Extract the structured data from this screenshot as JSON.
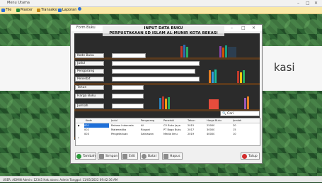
{
  "app": {
    "title": "Menu Utama",
    "menu": [
      {
        "label": "File",
        "icon": "file-icon",
        "color": "#2f6fd6"
      },
      {
        "label": "Master",
        "icon": "master-icon",
        "color": "#2a8a3c"
      },
      {
        "label": "Transaksi",
        "icon": "transaksi-icon",
        "color": "#c48a1a"
      },
      {
        "label": "Laporan",
        "icon": "laporan-icon",
        "color": "#2f6fd6"
      },
      {
        "label": "",
        "icon": "info-icon",
        "color": "#2f6fd6"
      }
    ],
    "banner_text": "kasi",
    "status": "USER: ADMIN   Admin: 12345   Hak akses: Admin   Tanggal: 11/05/2022   09:42:36 AM"
  },
  "form": {
    "title": "Form Buku",
    "heading_line1": "INPUT DATA BUKU",
    "heading_line2": "PERPUSTAKAAN SD ISLAM AL-MUNIR KOTA BEKASI",
    "labels": [
      "Kode Buku",
      "Judul",
      "Pengarang",
      "Penerbit",
      "Tahun",
      "Harga Buku",
      "Jumlah"
    ],
    "search_label": "Cari",
    "table": {
      "columns": [
        "Kode",
        "Judul",
        "Pengarang",
        "Penerbit",
        "Tahun",
        "Harga Buku",
        "Jumlah"
      ],
      "rows": [
        [
          "001",
          "Bahasa Indonesia",
          "Ali",
          "CV Buku Jaya",
          "2015",
          "25000",
          "20"
        ],
        [
          "002",
          "Matematika",
          "Rizgoni",
          "PT Bogo Buku",
          "2017",
          "30000",
          "15"
        ],
        [
          "003",
          "Pengetahuan",
          "Satriawan",
          "Media Ilmu",
          "2019",
          "40000",
          "10"
        ]
      ]
    },
    "buttons": [
      {
        "label": "Tambah",
        "icon": "add-icon",
        "color": "#2a9a3a"
      },
      {
        "label": "Simpan",
        "icon": "save-icon",
        "color": "#7a7a7a"
      },
      {
        "label": "Edit",
        "icon": "edit-icon",
        "color": "#7a7a7a"
      },
      {
        "label": "Batal",
        "icon": "cancel-icon",
        "color": "#7a7a7a"
      },
      {
        "label": "Hapus",
        "icon": "delete-icon",
        "color": "#7a7a7a"
      },
      {
        "label": "Tutup",
        "icon": "close-icon",
        "color": "#d22c2c"
      }
    ]
  }
}
